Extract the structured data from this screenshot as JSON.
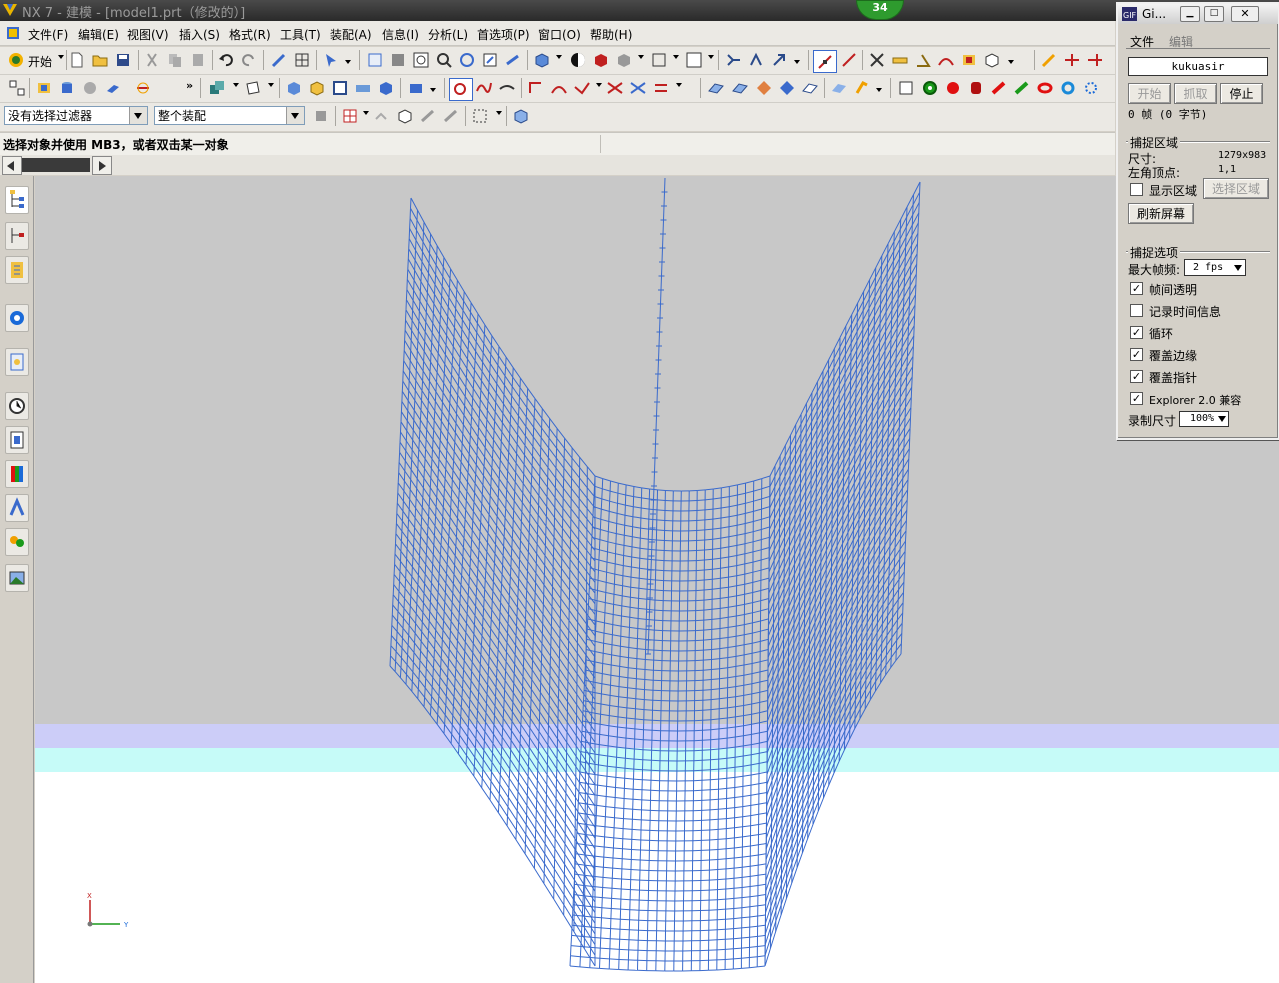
{
  "window": {
    "title": "NX 7 - 建模 - [model1.prt（修改的）]",
    "badge": "34"
  },
  "menubar": {
    "items": [
      "文件(F)",
      "编辑(E)",
      "视图(V)",
      "插入(S)",
      "格式(R)",
      "工具(T)",
      "装配(A)",
      "信息(I)",
      "分析(L)",
      "首选项(P)",
      "窗口(O)",
      "帮助(H)"
    ],
    "start_label": "开始"
  },
  "filters": {
    "selection_filter": "没有选择过滤器",
    "assembly_scope": "整个装配"
  },
  "status": {
    "prompt": "选择对象并使用 MB3，或者双击某一对象"
  },
  "viewport": {
    "surface_color": "#3a6acc",
    "band1_color": "#cccdf8",
    "band2_color": "#c6fbf8",
    "triad_x": "X",
    "triad_y": "Y"
  },
  "gif_recorder": {
    "title": "Gi...",
    "menu": [
      "文件",
      "编辑"
    ],
    "name": "kukuasir",
    "buttons": {
      "start": "开始",
      "capture": "抓取",
      "stop": "停止"
    },
    "frames": "0 帧 (0 字节)",
    "capture_area": {
      "group_label": "捕捉区域",
      "size_label": "尺寸:",
      "size_value": "1279x983",
      "corner_label": "左角顶点:",
      "corner_value": "1,1",
      "show_area_label": "显示区域",
      "select_area_button": "选择区域",
      "refresh_button": "刷新屏幕"
    },
    "capture_options": {
      "group_label": "捕捉选项",
      "max_fps_label": "最大帧频:",
      "max_fps_value": "2 fps",
      "options": [
        {
          "label": "帧间透明",
          "checked": true
        },
        {
          "label": "记录时间信息",
          "checked": false
        },
        {
          "label": "循环",
          "checked": true
        },
        {
          "label": "覆盖边缘",
          "checked": true
        },
        {
          "label": "覆盖指针",
          "checked": true
        },
        {
          "label": "Explorer 2.0 兼容",
          "checked": true
        }
      ],
      "record_size_label": "录制尺寸",
      "record_size_value": "100%"
    }
  }
}
